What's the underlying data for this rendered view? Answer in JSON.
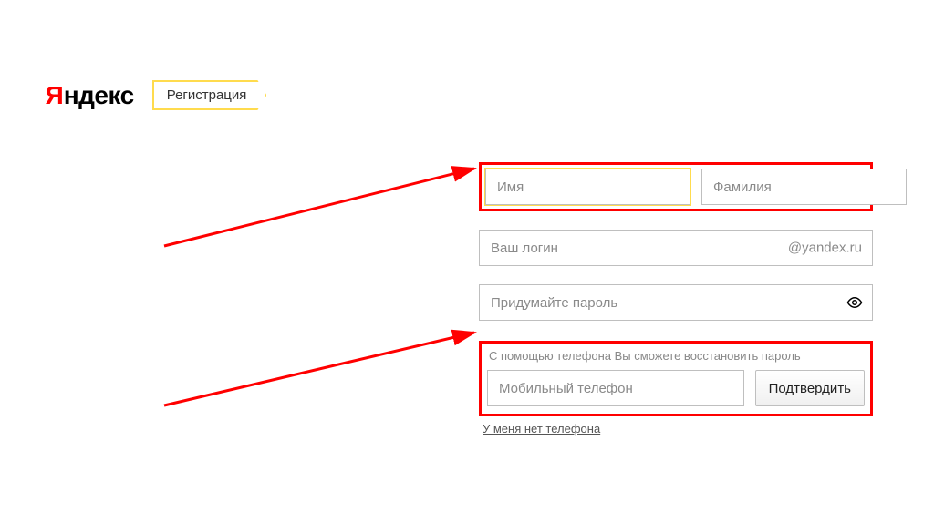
{
  "header": {
    "logo_text": "ндекс",
    "reg_label": "Регистрация"
  },
  "form": {
    "first_name_placeholder": "Имя",
    "last_name_placeholder": "Фамилия",
    "login_placeholder": "Ваш логин",
    "login_suffix": "@yandex.ru",
    "password_placeholder": "Придумайте пароль",
    "phone_hint": "С помощью телефона Вы сможете восстановить пароль",
    "phone_placeholder": "Мобильный телефон",
    "confirm_label": "Подтвердить",
    "no_phone_label": "У меня нет телефона"
  }
}
